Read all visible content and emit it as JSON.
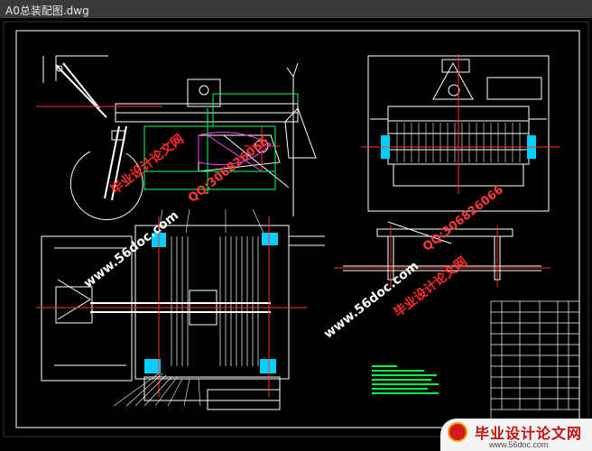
{
  "window": {
    "title": "A0总装配图.dwg"
  },
  "watermarks": {
    "left_site_cn": "毕业设计论文网",
    "left_site_url": "www.56doc.com",
    "left_qq": "QQ:306826066",
    "right_site_cn": "毕业设计论文网",
    "right_site_url": "www.56doc.com",
    "right_qq": "QQ:306826066"
  },
  "footer_banner": {
    "name": "毕业设计论文网",
    "url": "www.56doc.com"
  },
  "colors": {
    "background": "#000000",
    "frame": "#ffffff",
    "drawing": "#ffffff",
    "construction": "#00ff66",
    "section": "#ff3030",
    "cyan": "#00cfff",
    "magenta": "#ff40ff",
    "notes": "#00ff44"
  }
}
